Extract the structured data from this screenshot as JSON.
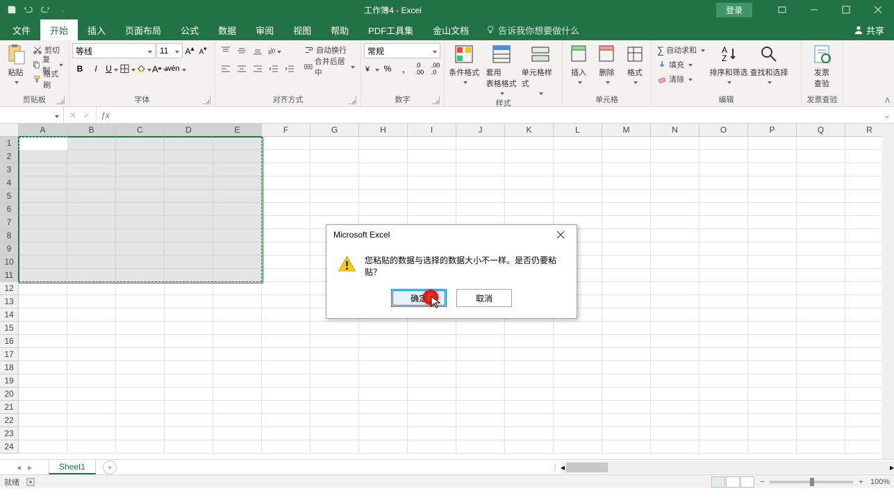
{
  "title": "工作簿4 - Excel",
  "login": "登录",
  "tabs": {
    "file": "文件",
    "home": "开始",
    "insert": "插入",
    "layout": "页面布局",
    "formulas": "公式",
    "data": "数据",
    "review": "审阅",
    "view": "视图",
    "help": "帮助",
    "pdf": "PDF工具集",
    "jinshan": "金山文档",
    "tellme": "告诉我你想要做什么",
    "share": "共享"
  },
  "ribbon": {
    "clipboard": {
      "label": "剪贴板",
      "paste": "粘贴",
      "cut": "剪切",
      "copy": "复制",
      "fmt": "格式刷"
    },
    "font": {
      "label": "字体",
      "name": "等线",
      "size": "11"
    },
    "align": {
      "label": "对齐方式",
      "wrap": "自动换行",
      "merge": "合并后居中"
    },
    "number": {
      "label": "数字",
      "fmt": "常规"
    },
    "styles": {
      "label": "样式",
      "cond": "条件格式",
      "tbl": "套用\n表格格式",
      "cell": "单元格样式"
    },
    "cells": {
      "label": "单元格",
      "insert": "插入",
      "delete": "删除",
      "format": "格式"
    },
    "editing": {
      "label": "编辑",
      "sum": "自动求和",
      "fill": "填充",
      "clear": "清除",
      "sort": "排序和筛选",
      "find": "查找和选择"
    },
    "invoice": {
      "label": "发票查验",
      "btn": "发票\n查验"
    }
  },
  "namebox": "",
  "columns": [
    "A",
    "B",
    "C",
    "D",
    "E",
    "F",
    "G",
    "H",
    "I",
    "J",
    "K",
    "L",
    "M",
    "N",
    "O",
    "P",
    "Q",
    "R"
  ],
  "rows": [
    1,
    2,
    3,
    4,
    5,
    6,
    7,
    8,
    9,
    10,
    11,
    12,
    13,
    14,
    15,
    16,
    17,
    18,
    19,
    20,
    21,
    22,
    23,
    24
  ],
  "selection": {
    "cols": [
      "A",
      "B",
      "C",
      "D",
      "E"
    ],
    "rows": [
      1,
      2,
      3,
      4,
      5,
      6,
      7,
      8,
      9,
      10,
      11
    ]
  },
  "sheet": {
    "name": "Sheet1"
  },
  "status": {
    "ready": "就绪",
    "zoom": "100%"
  },
  "dialog": {
    "title": "Microsoft Excel",
    "msg": "您粘贴的数据与选择的数据大小不一样。是否仍要粘贴？",
    "ok": "确定",
    "cancel": "取消"
  }
}
